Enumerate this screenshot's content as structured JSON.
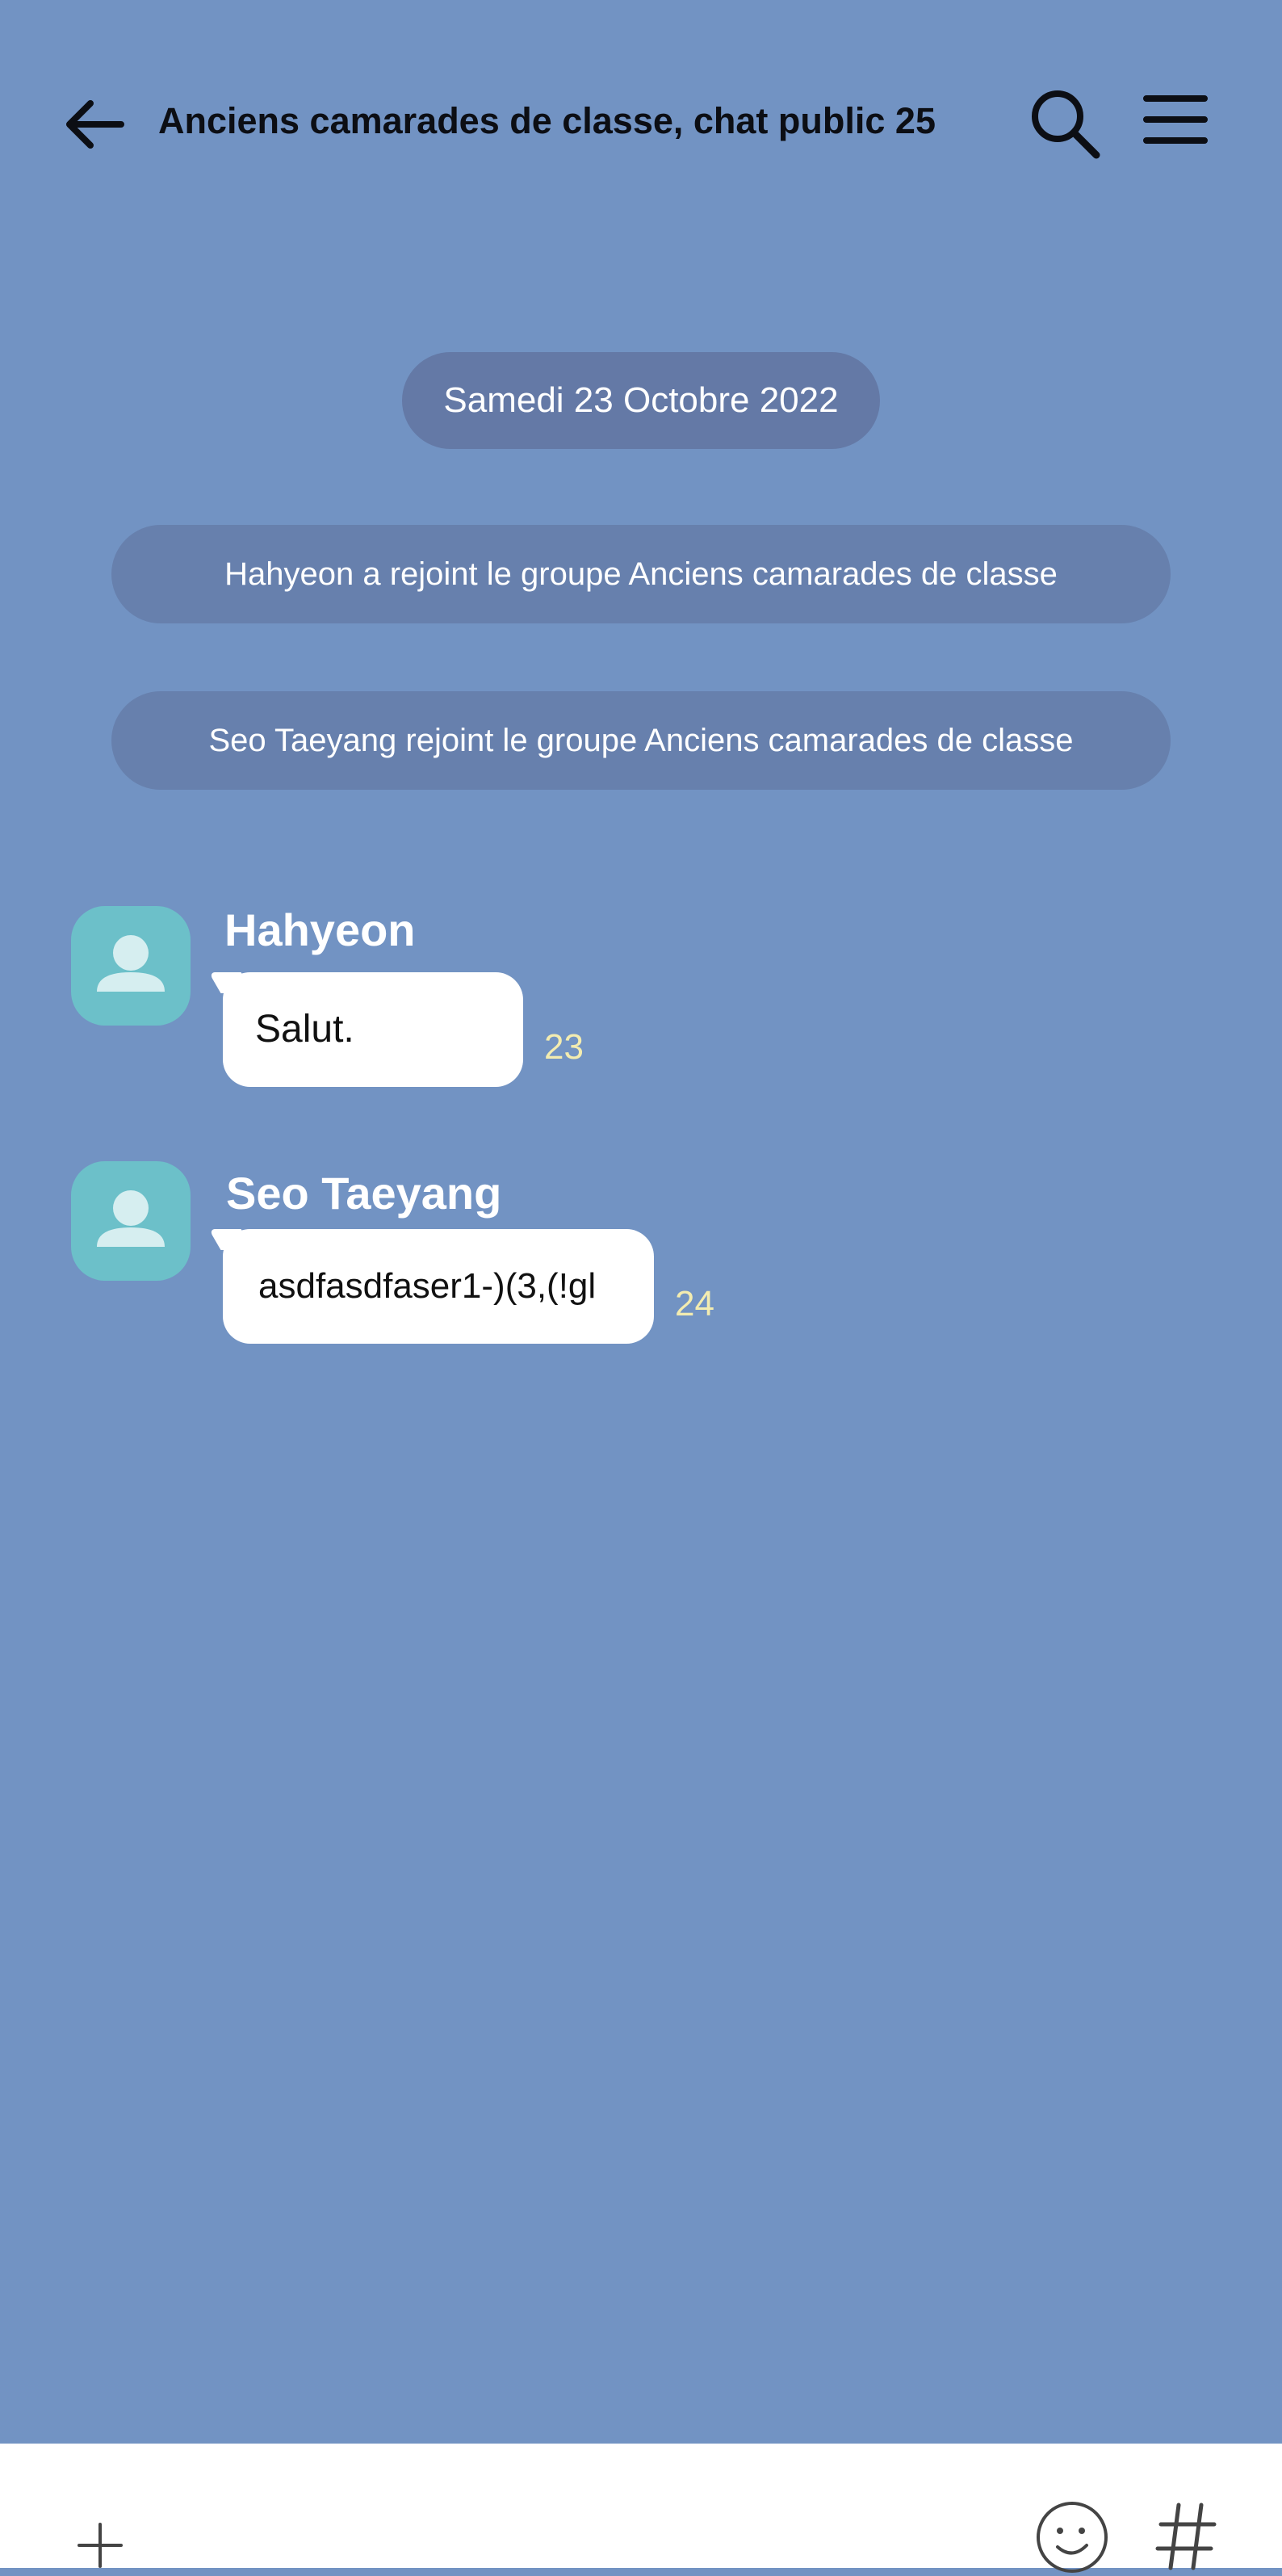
{
  "header": {
    "title": "Anciens camarades de classe, chat public 25",
    "back_icon": "arrow-left-icon",
    "search_icon": "search-icon",
    "menu_icon": "hamburger-menu-icon"
  },
  "date_separator": "Samedi 23 Octobre 2022",
  "system_messages": [
    "Hahyeon a rejoint le groupe Anciens camarades de classe",
    "Seo Taeyang rejoint le groupe Anciens camarades de classe"
  ],
  "messages": [
    {
      "sender": "Hahyeon",
      "text": "Salut.",
      "count": "23",
      "avatar_icon": "default-user-avatar-icon"
    },
    {
      "sender": "Seo Taeyang",
      "text": "asdfasdfaser1-)(3,(!gl",
      "count": "24",
      "avatar_icon": "default-user-avatar-icon"
    }
  ],
  "input_bar": {
    "plus_icon": "plus-icon",
    "emoji_icon": "emoji-icon",
    "hashtag_icon": "hashtag-icon"
  },
  "colors": {
    "background": "#7293c3",
    "avatar": "#6cc0c9",
    "count": "#f3ecb0",
    "pill": "#6780ad"
  }
}
